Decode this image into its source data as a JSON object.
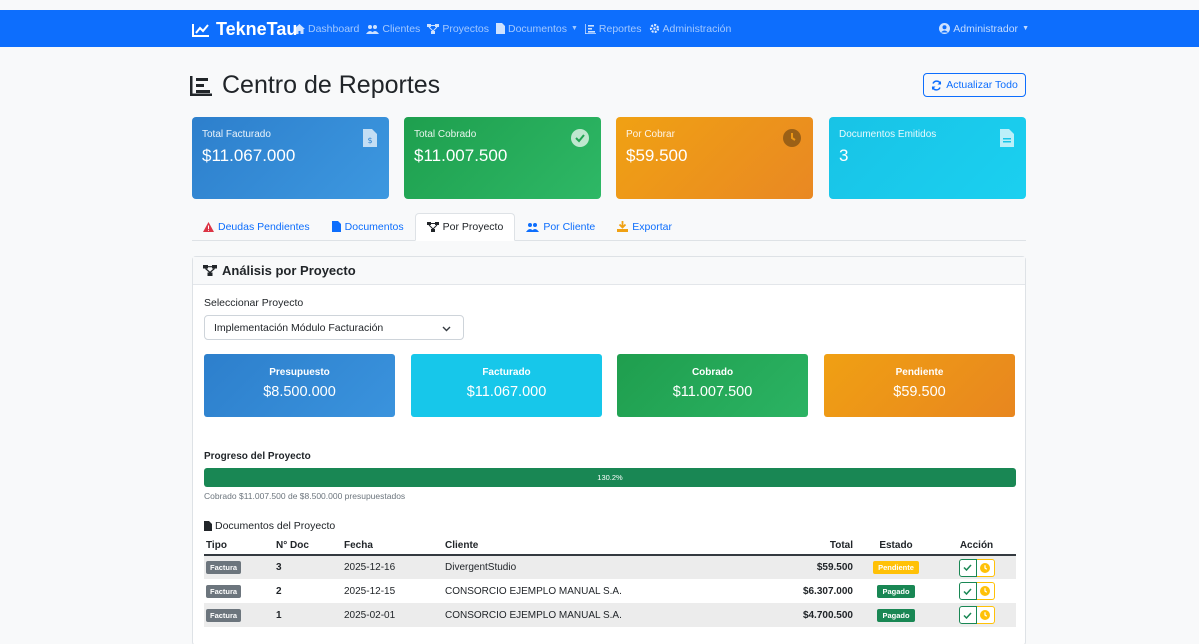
{
  "navbar": {
    "brand": "TekneTau",
    "items": [
      {
        "label": "Dashboard",
        "icon": "home-icon"
      },
      {
        "label": "Clientes",
        "icon": "users-icon"
      },
      {
        "label": "Proyectos",
        "icon": "project-diagram-icon"
      },
      {
        "label": "Documentos",
        "icon": "file-icon"
      },
      {
        "label": "Reportes",
        "icon": "chart-bar-icon"
      },
      {
        "label": "Administración",
        "icon": "cog-icon"
      }
    ],
    "user": "Administrador"
  },
  "header": {
    "title": "Centro de Reportes",
    "refresh_label": "Actualizar Todo"
  },
  "stats": [
    {
      "label": "Total Facturado",
      "value": "$11.067.000",
      "icon": "file-invoice-dollar-icon"
    },
    {
      "label": "Total Cobrado",
      "value": "$11.007.500",
      "icon": "check-circle-icon"
    },
    {
      "label": "Por Cobrar",
      "value": "$59.500",
      "icon": "clock-icon"
    },
    {
      "label": "Documentos Emitidos",
      "value": "3",
      "icon": "file-alt-icon"
    }
  ],
  "tabs": [
    {
      "label": "Deudas Pendientes",
      "icon": "warning-icon"
    },
    {
      "label": "Documentos",
      "icon": "file-icon"
    },
    {
      "label": "Por Proyecto",
      "icon": "project-diagram-icon",
      "active": true
    },
    {
      "label": "Por Cliente",
      "icon": "users-icon"
    },
    {
      "label": "Exportar",
      "icon": "download-icon"
    }
  ],
  "panel": {
    "title": "Análisis por Proyecto",
    "select_label": "Seleccionar Proyecto",
    "selected_project": "Implementación Módulo Facturación",
    "kpis": [
      {
        "label": "Presupuesto",
        "value": "$8.500.000"
      },
      {
        "label": "Facturado",
        "value": "$11.067.000"
      },
      {
        "label": "Cobrado",
        "value": "$11.007.500"
      },
      {
        "label": "Pendiente",
        "value": "$59.500"
      }
    ],
    "progress": {
      "title": "Progreso del Proyecto",
      "percent_label": "130.2%",
      "percent": 130.2,
      "note": "Cobrado $11.007.500 de $8.500.000 presupuestados"
    },
    "docs_title": "Documentos del Proyecto",
    "table": {
      "headers": [
        "Tipo",
        "N° Doc",
        "Fecha",
        "Cliente",
        "Total",
        "Estado",
        "Acción"
      ],
      "rows": [
        {
          "tipo": "Factura",
          "num": "3",
          "fecha": "2025-12-16",
          "cliente": "DivergentStudio",
          "total": "$59.500",
          "estado": "Pendiente",
          "estado_color": "#ffc107"
        },
        {
          "tipo": "Factura",
          "num": "2",
          "fecha": "2025-12-15",
          "cliente": "CONSORCIO EJEMPLO MANUAL S.A.",
          "total": "$6.307.000",
          "estado": "Pagado",
          "estado_color": "#198754"
        },
        {
          "tipo": "Factura",
          "num": "1",
          "fecha": "2025-02-01",
          "cliente": "CONSORCIO EJEMPLO MANUAL S.A.",
          "total": "$4.700.500",
          "estado": "Pagado",
          "estado_color": "#198754"
        }
      ]
    }
  },
  "colors": {
    "primary": "#0d6efd",
    "success": "#198754",
    "warning": "#ffc107"
  }
}
